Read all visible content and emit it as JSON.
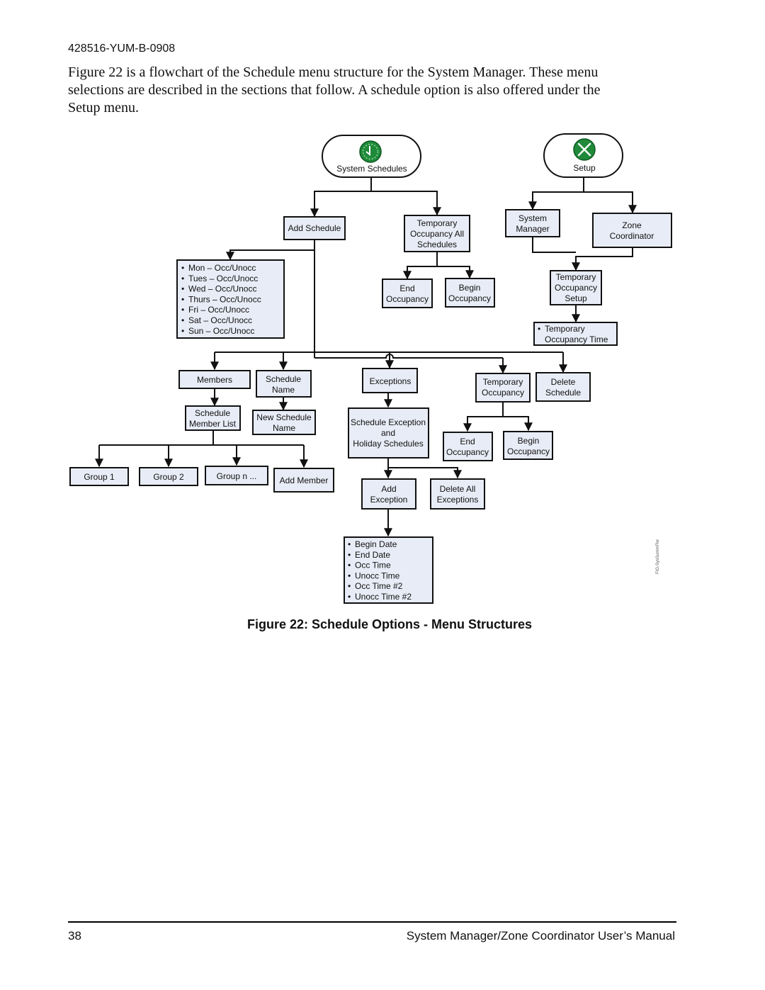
{
  "header": {
    "doc_id": "428516-YUM-B-0908",
    "intro": "Figure 22 is a flowchart of the Schedule menu structure for the System Manager. These menu selections are described in the sections that follow. A schedule option is also offered under the Setup menu."
  },
  "figure": {
    "caption": "Figure 22: Schedule Options - Menu Structures",
    "tag": "FIG-SysSummFlw",
    "colors": {
      "box_fill": "#e8ecf6",
      "icon_green": "#1f8a3a",
      "line": "#111111"
    },
    "roots": {
      "system_schedules": {
        "label": "System Schedules",
        "icon": "clock-icon"
      },
      "setup": {
        "label": "Setup",
        "icon": "tools-icon"
      }
    },
    "nodes": {
      "add_schedule": "Add Schedule",
      "temp_occ_all": [
        "Temporary",
        "Occupancy All",
        "Schedules"
      ],
      "end_occ_1": [
        "End",
        "Occupancy"
      ],
      "begin_occ_1": [
        "Begin",
        "Occupancy"
      ],
      "days": [
        "Mon – Occ/Unocc",
        "Tues – Occ/Unocc",
        "Wed – Occ/Unocc",
        "Thurs – Occ/Unocc",
        "Fri – Occ/Unocc",
        "Sat – Occ/Unocc",
        "Sun – Occ/Unocc"
      ],
      "system_manager": [
        "System",
        "Manager"
      ],
      "zone_coordinator": [
        "Zone",
        "Coordinator"
      ],
      "temp_occ_setup": [
        "Temporary",
        "Occupancy",
        "Setup"
      ],
      "temp_occ_time": [
        "Temporary",
        "Occupancy Time"
      ],
      "members": "Members",
      "schedule_name": [
        "Schedule",
        "Name"
      ],
      "schedule_member_list": [
        "Schedule",
        "Member List"
      ],
      "new_schedule_name": [
        "New Schedule",
        "Name"
      ],
      "group_1": "Group 1",
      "group_2": "Group 2",
      "group_n": "Group n ...",
      "add_member": "Add Member",
      "exceptions": "Exceptions",
      "sched_exc_holiday": [
        "Schedule Exception",
        "and",
        "Holiday Schedules"
      ],
      "temp_occ": [
        "Temporary",
        "Occupancy"
      ],
      "delete_schedule": [
        "Delete",
        "Schedule"
      ],
      "end_occ_2": [
        "End",
        "Occupancy"
      ],
      "begin_occ_2": [
        "Begin",
        "Occupancy"
      ],
      "add_exception": [
        "Add",
        "Exception"
      ],
      "delete_all_exceptions": [
        "Delete All",
        "Exceptions"
      ],
      "exception_fields": [
        "Begin Date",
        "End Date",
        "Occ Time",
        "Unocc Time",
        "Occ Time #2",
        "Unocc Time #2"
      ]
    }
  },
  "footer": {
    "page_number": "38",
    "manual_title": "System Manager/Zone Coordinator User’s Manual"
  }
}
